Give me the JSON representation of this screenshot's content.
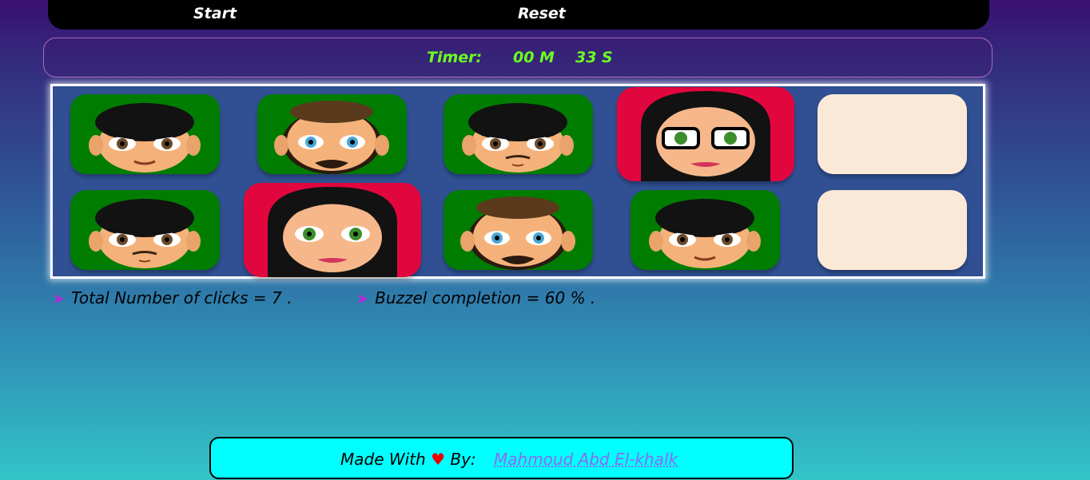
{
  "controls": {
    "start_label": "Start",
    "reset_label": "Reset"
  },
  "timer": {
    "label": "Timer:",
    "minutes": "00 M",
    "seconds": "33 S"
  },
  "board": {
    "cards": [
      {
        "state": "revealed",
        "face": "man-black-hair",
        "color": "#007d00"
      },
      {
        "state": "revealed",
        "face": "man-beard",
        "color": "#007d00"
      },
      {
        "state": "revealed",
        "face": "man-mustache",
        "color": "#007d00"
      },
      {
        "state": "revealed",
        "face": "woman-glasses",
        "color": "#e2063f"
      },
      {
        "state": "hidden",
        "face": "",
        "color": "#fbe9d7"
      },
      {
        "state": "revealed",
        "face": "man-mustache",
        "color": "#007d00"
      },
      {
        "state": "revealed",
        "face": "woman",
        "color": "#e2063f"
      },
      {
        "state": "revealed",
        "face": "man-beard",
        "color": "#007d00"
      },
      {
        "state": "revealed",
        "face": "man-black-hair",
        "color": "#007d00"
      },
      {
        "state": "hidden",
        "face": "",
        "color": "#fbe9d7"
      }
    ]
  },
  "stats": {
    "clicks_text": "Total Number of clicks = 7 .",
    "completion_text": "Buzzel completion = 60 % ."
  },
  "footer": {
    "made_with": "Made With",
    "by": "By:",
    "author": "Mahmoud Abd El-khalk"
  }
}
